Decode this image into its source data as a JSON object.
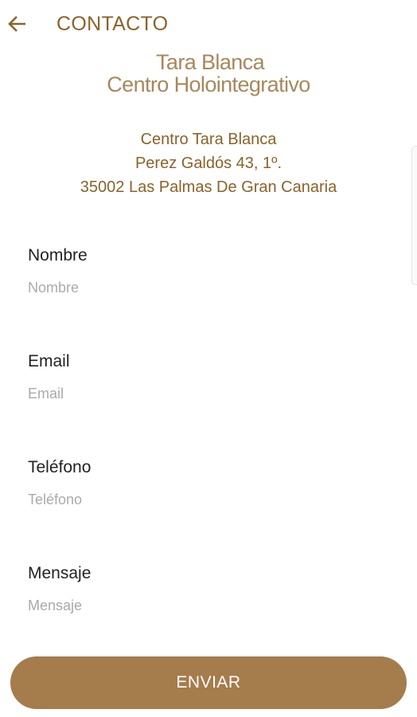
{
  "header": {
    "back_icon": "arrow-left-icon",
    "title": "CONTACTO",
    "accent_color": "#8b6228"
  },
  "logo": {
    "line1": "Tara Blanca",
    "line2": "Centro Holointegrativo",
    "color": "#a7885b"
  },
  "address": {
    "line1": "Centro Tara Blanca",
    "line2": "Perez Galdós 43, 1º.",
    "line3": "35002 Las Palmas De Gran Canaria"
  },
  "form": {
    "name": {
      "label": "Nombre",
      "placeholder": "Nombre",
      "value": ""
    },
    "email": {
      "label": "Email",
      "placeholder": "Email",
      "value": ""
    },
    "phone": {
      "label": "Teléfono",
      "placeholder": "Teléfono",
      "value": ""
    },
    "message": {
      "label": "Mensaje",
      "placeholder": "Mensaje",
      "value": ""
    }
  },
  "submit": {
    "label": "ENVIAR",
    "color": "#a57c4b"
  }
}
